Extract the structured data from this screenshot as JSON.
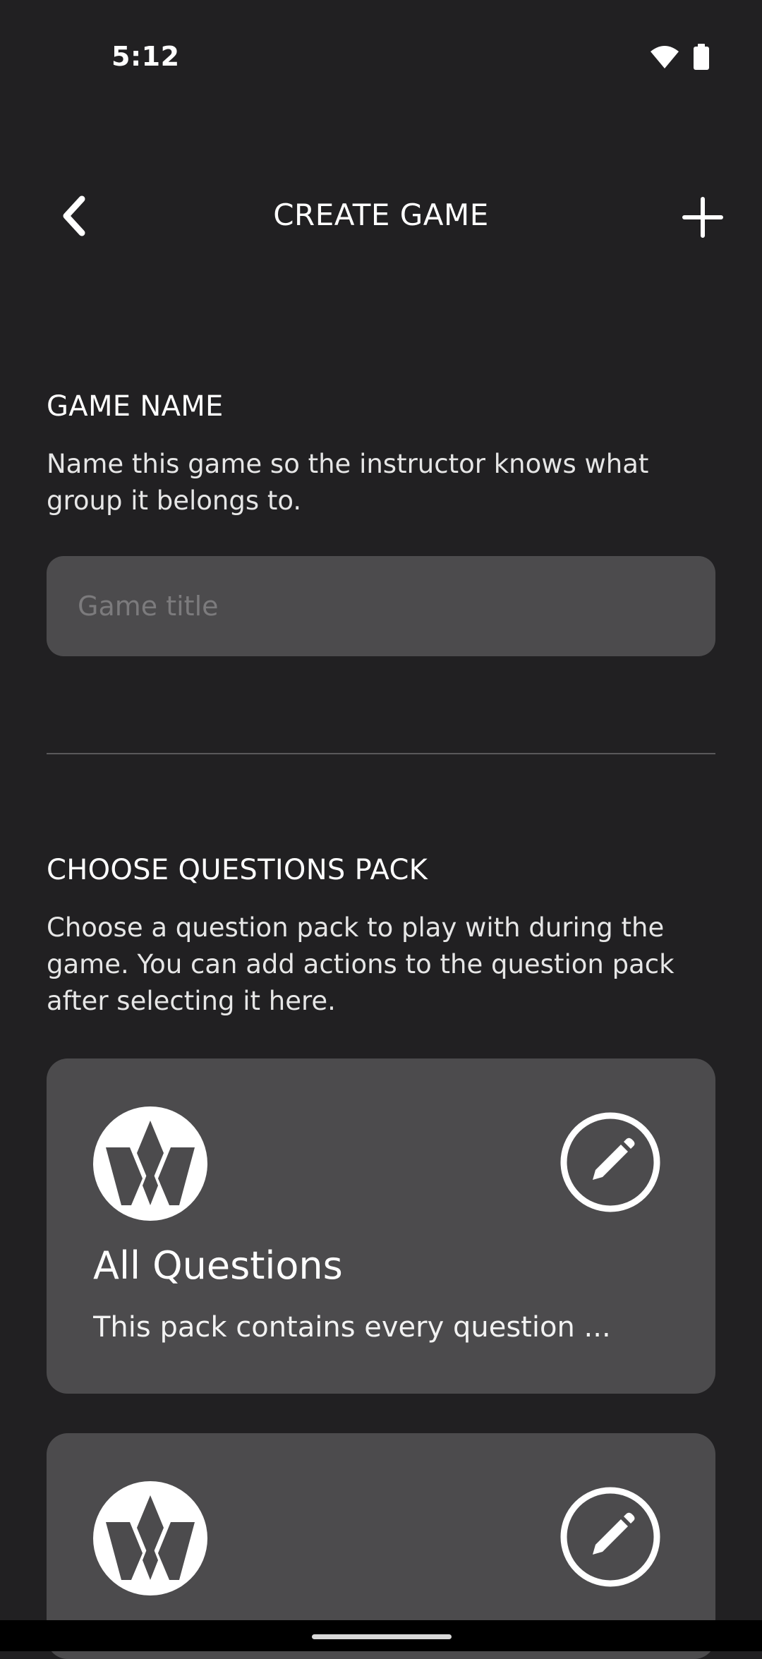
{
  "status_bar": {
    "time": "5:12",
    "icons": [
      "wifi-icon",
      "battery-icon"
    ]
  },
  "header": {
    "title": "CREATE GAME",
    "back_icon": "chevron-left-icon",
    "add_icon": "plus-icon"
  },
  "game_name": {
    "title": "GAME NAME",
    "description": "Name this game so the instructor knows what group it belongs to.",
    "input_placeholder": "Game title",
    "input_value": ""
  },
  "questions_pack": {
    "title": "CHOOSE QUESTIONS PACK",
    "description": "Choose a question pack to play with during the game. You can add actions to the question pack after selecting it here.",
    "packs": [
      {
        "name": "All Questions",
        "description": "This pack contains every question ...",
        "logo_icon": "w-logo-icon",
        "edit_icon": "pencil-circle-icon"
      },
      {
        "name": "",
        "description": "",
        "logo_icon": "w-logo-icon",
        "edit_icon": "pencil-circle-icon"
      }
    ]
  },
  "colors": {
    "background": "#212022",
    "card": "#4c4b4d",
    "text": "#ffffff",
    "placeholder": "#7c7b7d"
  }
}
